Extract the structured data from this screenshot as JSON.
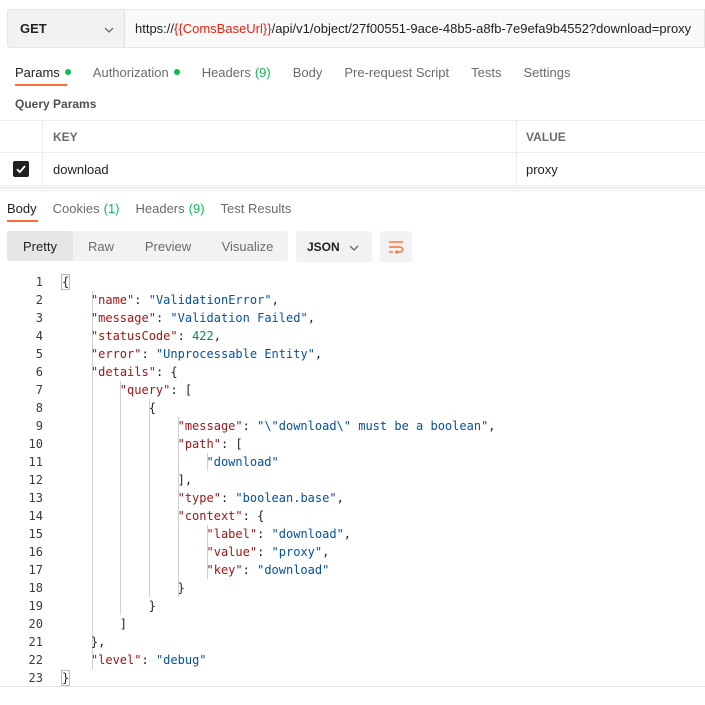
{
  "request": {
    "method": "GET",
    "url_prefix": "https://",
    "url_variable": "{{ComsBaseUrl}}",
    "url_suffix": "/api/v1/object/27f00551-9ace-48b5-a8fb-7e9efa9b4552?download=proxy"
  },
  "request_tabs": {
    "params": "Params",
    "authorization": "Authorization",
    "headers": "Headers",
    "headers_count": "(9)",
    "body": "Body",
    "prerequest": "Pre-request Script",
    "tests": "Tests",
    "settings": "Settings"
  },
  "query_params": {
    "title": "Query Params",
    "key_header": "KEY",
    "value_header": "VALUE",
    "rows": [
      {
        "key": "download",
        "value": "proxy",
        "enabled": true
      }
    ]
  },
  "response_tabs": {
    "body": "Body",
    "cookies": "Cookies",
    "cookies_count": "(1)",
    "headers": "Headers",
    "headers_count": "(9)",
    "test_results": "Test Results"
  },
  "format": {
    "pretty": "Pretty",
    "raw": "Raw",
    "preview": "Preview",
    "visualize": "Visualize",
    "language": "JSON"
  },
  "colors": {
    "accent": "#ff6c37",
    "status_dot": "#0cbb52",
    "url_variable": "#eb2013",
    "json_key": "#a31515",
    "json_string": "#0451a5",
    "json_number": "#098658"
  },
  "code_lines": [
    {
      "n": "1"
    },
    {
      "n": "2"
    },
    {
      "n": "3"
    },
    {
      "n": "4"
    },
    {
      "n": "5"
    },
    {
      "n": "6"
    },
    {
      "n": "7"
    },
    {
      "n": "8"
    },
    {
      "n": "9"
    },
    {
      "n": "10"
    },
    {
      "n": "11"
    },
    {
      "n": "12"
    },
    {
      "n": "13"
    },
    {
      "n": "14"
    },
    {
      "n": "15"
    },
    {
      "n": "16"
    },
    {
      "n": "17"
    },
    {
      "n": "18"
    },
    {
      "n": "19"
    },
    {
      "n": "20"
    },
    {
      "n": "21"
    },
    {
      "n": "22"
    },
    {
      "n": "23"
    }
  ],
  "response_json": {
    "name": "ValidationError",
    "message": "Validation Failed",
    "statusCode": 422,
    "error": "Unprocessable Entity",
    "details_key": "details",
    "query_key": "query",
    "item_message": "\\\"download\\\" must be a boolean",
    "path_key": "path",
    "path_value": "download",
    "type_key": "type",
    "type_value": "boolean.base",
    "context_key": "context",
    "context_label": "download",
    "context_value": "proxy",
    "context_key_value": "download",
    "level": "debug"
  }
}
